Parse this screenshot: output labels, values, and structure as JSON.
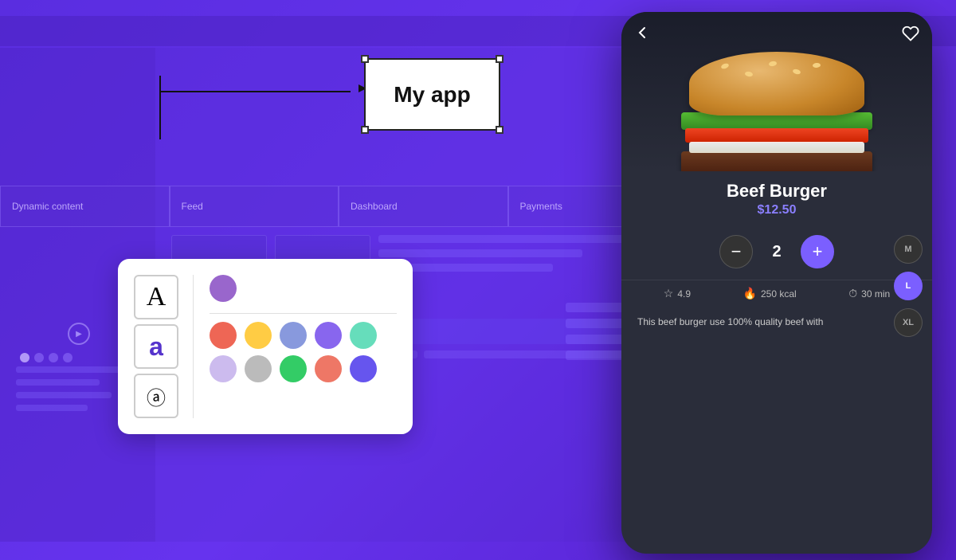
{
  "background": {
    "color": "#5c2fd6"
  },
  "wireframe": {
    "sections": [
      {
        "label": "Dynamic content"
      },
      {
        "label": "Feed"
      },
      {
        "label": "Dashboard"
      },
      {
        "label": "Payments"
      }
    ]
  },
  "myapp_box": {
    "label": "My app"
  },
  "palette_card": {
    "fonts": [
      {
        "symbol": "A",
        "style": "serif"
      },
      {
        "symbol": "a",
        "style": "blue"
      },
      {
        "symbol": "ⓐ",
        "style": "circled"
      }
    ],
    "top_color": {
      "hex": "#9966cc"
    },
    "color_rows": [
      [
        {
          "hex": "#ee6655"
        },
        {
          "hex": "#ffcc44"
        },
        {
          "hex": "#8899dd"
        },
        {
          "hex": "#8866ee"
        },
        {
          "hex": "#66ddbb"
        }
      ],
      [
        {
          "hex": "#ccbbee"
        },
        {
          "hex": "#bbbbbb"
        },
        {
          "hex": "#33cc66"
        },
        {
          "hex": "#ee7766"
        },
        {
          "hex": "#6655ee"
        }
      ]
    ]
  },
  "phone": {
    "back_icon": "‹",
    "heart_icon": "♡",
    "burger_name": "Beef Burger",
    "burger_price": "$12.50",
    "burger_emoji": "🍔",
    "sizes": [
      {
        "label": "M",
        "active": false
      },
      {
        "label": "L",
        "active": true
      },
      {
        "label": "XL",
        "active": false
      }
    ],
    "quantity": {
      "minus_label": "−",
      "plus_label": "+",
      "value": "2"
    },
    "stats": [
      {
        "icon": "☆",
        "value": "4.9"
      },
      {
        "icon": "🔥",
        "value": "250 kcal"
      },
      {
        "icon": "⏱",
        "value": "30 min"
      }
    ],
    "description": "This beef burger use 100% quality beef with"
  },
  "arrow": {
    "label": "arrow pointing to myapp"
  }
}
